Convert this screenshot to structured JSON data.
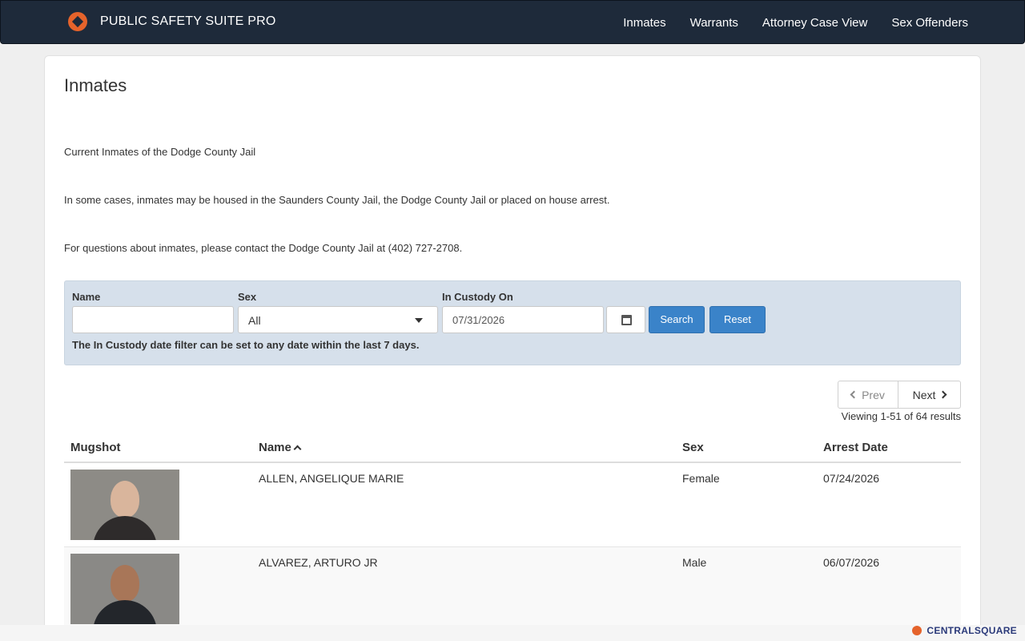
{
  "header": {
    "brand": "PUBLIC SAFETY SUITE PRO",
    "nav": [
      "Inmates",
      "Warrants",
      "Attorney Case View",
      "Sex Offenders"
    ]
  },
  "page": {
    "title": "Inmates",
    "paragraphs": [
      "Current Inmates of the Dodge County Jail",
      "In some cases, inmates may be housed in the Saunders County Jail, the Dodge County Jail or placed on house arrest.",
      "For questions about inmates, please contact the Dodge County Jail at (402) 727-2708."
    ]
  },
  "filter": {
    "name_label": "Name",
    "name_value": "",
    "sex_label": "Sex",
    "sex_value": "All",
    "custody_label": "In Custody On",
    "custody_value": "07/31/2026",
    "search_label": "Search",
    "reset_label": "Reset",
    "note": "The In Custody date filter can be set to any date within the last 7 days."
  },
  "pagination": {
    "prev_label": "Prev",
    "next_label": "Next",
    "viewing": "Viewing 1-51 of 64 results"
  },
  "table": {
    "headers": [
      "Mugshot",
      "Name",
      "Sex",
      "Arrest Date"
    ],
    "rows": [
      {
        "name": "ALLEN, ANGELIQUE MARIE",
        "sex": "Female",
        "arrest_date": "07/24/2026"
      },
      {
        "name": "ALVAREZ, ARTURO JR",
        "sex": "Male",
        "arrest_date": "06/07/2026"
      }
    ]
  },
  "footer": {
    "vendor": "CENTRALSQUARE"
  },
  "colors": {
    "navbar": "#1e2a3a",
    "accent": "#e5632b",
    "primary_button": "#3a83c9",
    "filter_panel": "#d6e0eb"
  }
}
